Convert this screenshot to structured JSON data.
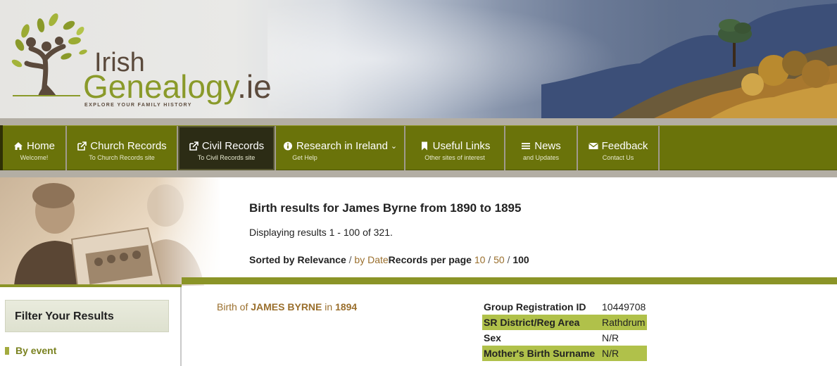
{
  "header": {
    "logo_irish": "Irish",
    "logo_genealogy": "Genealogy",
    "logo_ie": ".ie",
    "logo_tagline": "EXPLORE YOUR FAMILY HISTORY"
  },
  "nav": {
    "items": [
      {
        "label": "Home",
        "sub": "Welcome!",
        "icon": "home-icon"
      },
      {
        "label": "Church Records",
        "sub": "To Church Records site",
        "icon": "external-link-icon"
      },
      {
        "label": "Civil Records",
        "sub": "To Civil Records site",
        "icon": "external-link-icon",
        "active": true
      },
      {
        "label": "Research in Ireland",
        "sub": "Get Help",
        "icon": "info-icon"
      },
      {
        "label": "Useful Links",
        "sub": "Other sites of interest",
        "icon": "bookmark-icon"
      },
      {
        "label": "News",
        "sub": "and Updates",
        "icon": "list-icon"
      },
      {
        "label": "Feedback",
        "sub": "Contact Us",
        "icon": "envelope-icon"
      }
    ]
  },
  "results": {
    "title": "Birth results for James Byrne from 1890 to 1895",
    "count": "Displaying results 1 - 100 of 321.",
    "sort_label": "Sorted by",
    "sort_relevance": "Relevance",
    "sort_sep": "/",
    "sort_date": "by Date",
    "per_page_label": "Records per page",
    "per_page_10": "10",
    "per_page_50": "50",
    "per_page_100": "100"
  },
  "sidebar": {
    "filter_title": "Filter Your Results",
    "by_event": "By event"
  },
  "record": {
    "prefix": "Birth of",
    "name": "JAMES BYRNE",
    "in": "in",
    "year": "1894",
    "fields": [
      {
        "key": "Group Registration ID",
        "value": "10449708"
      },
      {
        "key": "SR District/Reg Area",
        "value": "Rathdrum"
      },
      {
        "key": "Sex",
        "value": "N/R"
      },
      {
        "key": "Mother's Birth Surname",
        "value": "N/R"
      }
    ]
  },
  "colors": {
    "nav_green": "#6a730a",
    "accent_green": "#8b9427",
    "highlight_row": "#b0c14a",
    "link_brown": "#9a6f2d"
  }
}
